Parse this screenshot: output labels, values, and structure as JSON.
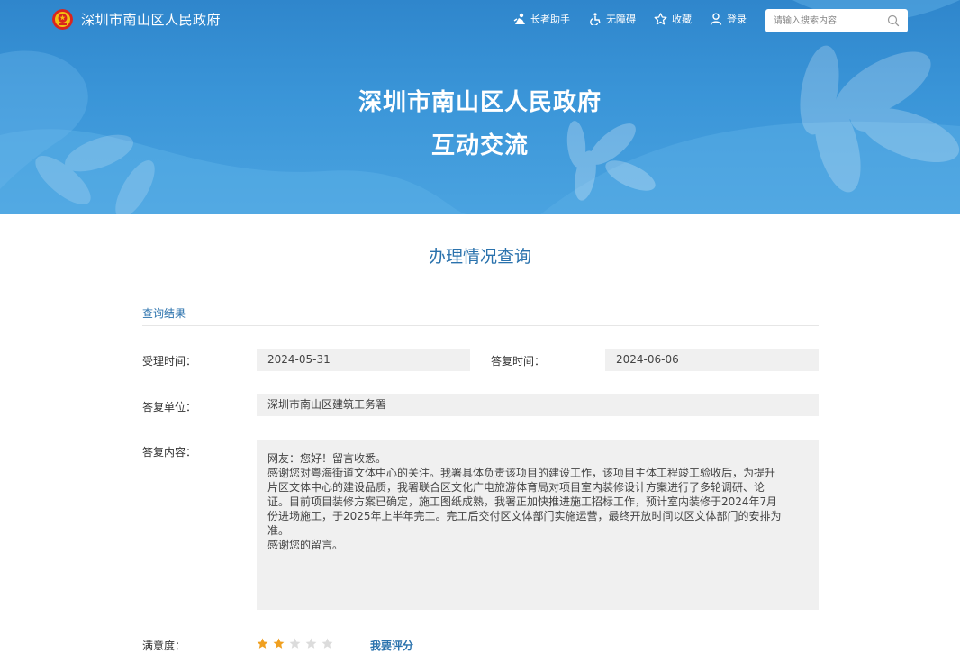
{
  "header": {
    "site_name": "深圳市南山区人民政府",
    "emblem_icon": "national-emblem-icon",
    "nav": [
      {
        "label": "长者助手",
        "icon": "elder-assistant-icon"
      },
      {
        "label": "无障碍",
        "icon": "accessibility-icon"
      },
      {
        "label": "收藏",
        "icon": "star-outline-icon"
      },
      {
        "label": "登录",
        "icon": "user-icon"
      }
    ],
    "search": {
      "placeholder": "请输入搜索内容",
      "icon": "search-icon"
    }
  },
  "banner": {
    "title": "深圳市南山区人民政府",
    "subtitle": "互动交流",
    "bg_color": "#3a95d8"
  },
  "main": {
    "heading": "办理情况查询",
    "section_title": "查询结果",
    "fields": {
      "accept_time_label": "受理时间：",
      "accept_time": "2024-05-31",
      "reply_time_label": "答复时间：",
      "reply_time": "2024-06-06",
      "reply_unit_label": "答复单位：",
      "reply_unit": "深圳市南山区建筑工务署",
      "reply_content_label": "答复内容："
    },
    "reply_lines": [
      "网友：您好！留言收悉。",
      "感谢您对粤海街道文体中心的关注。我署具体负责该项目的建设工作，该项目主体工程竣工验收后，为提升",
      "片区文体中心的建设品质，我署联合区文化广电旅游体育局对项目室内装修设计方案进行了多轮调研、论",
      "证。目前项目装修方案已确定，施工图纸成熟，我署正加快推进施工招标工作，预计室内装修于2024年7月",
      "份进场施工，于2025年上半年完工。完工后交付区文体部门实施运营，最终开放时间以区文体部门的安排为",
      "准。",
      "感谢您的留言。"
    ],
    "satisfaction": {
      "label": "满意度：",
      "rating": 2,
      "max": 5,
      "rate_link": "我要评分"
    }
  },
  "colors": {
    "accent": "#2a72ad",
    "star_filled": "#f0a020",
    "star_empty": "#dcdcdc",
    "field_bg": "#f0f0f0"
  }
}
